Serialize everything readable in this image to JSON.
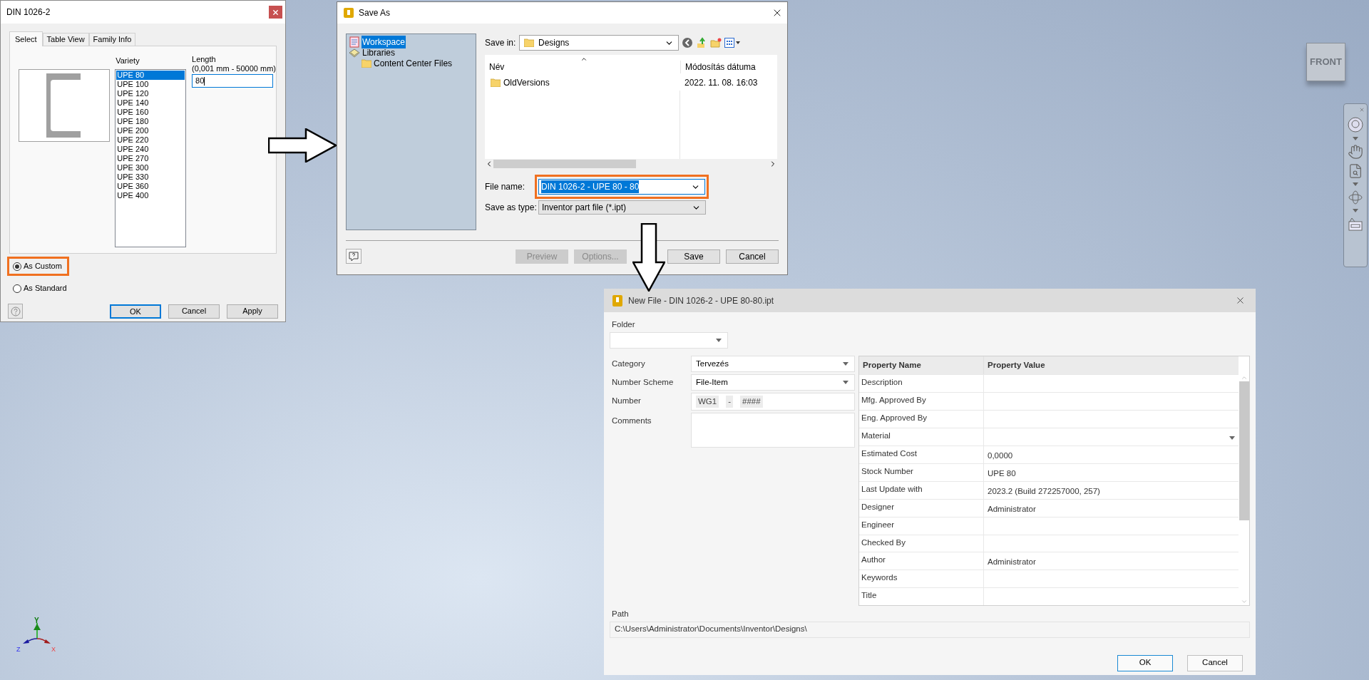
{
  "din_dialog": {
    "title": "DIN 1026-2",
    "tabs": [
      {
        "label": "Select",
        "selected": true
      },
      {
        "label": "Table View",
        "selected": false
      },
      {
        "label": "Family Info",
        "selected": false
      }
    ],
    "variety_label": "Variety",
    "varieties": [
      {
        "label": "UPE 80",
        "selected": true
      },
      {
        "label": "UPE 100",
        "selected": false
      },
      {
        "label": "UPE 120",
        "selected": false
      },
      {
        "label": "UPE 140",
        "selected": false
      },
      {
        "label": "UPE 160",
        "selected": false
      },
      {
        "label": "UPE 180",
        "selected": false
      },
      {
        "label": "UPE 200",
        "selected": false
      },
      {
        "label": "UPE 220",
        "selected": false
      },
      {
        "label": "UPE 240",
        "selected": false
      },
      {
        "label": "UPE 270",
        "selected": false
      },
      {
        "label": "UPE 300",
        "selected": false
      },
      {
        "label": "UPE 330",
        "selected": false
      },
      {
        "label": "UPE 360",
        "selected": false
      },
      {
        "label": "UPE 400",
        "selected": false
      }
    ],
    "length_label": "Length",
    "length_range": "(0,001 mm - 50000 mm)",
    "length_value": "80",
    "options": [
      {
        "label": "As Custom",
        "selected": true,
        "highlighted": true
      },
      {
        "label": "As Standard",
        "selected": false,
        "highlighted": false
      }
    ],
    "buttons": [
      {
        "label": "OK",
        "default": true
      },
      {
        "label": "Cancel",
        "default": false
      },
      {
        "label": "Apply",
        "default": false
      }
    ]
  },
  "save_as": {
    "title": "Save As",
    "places": [
      {
        "label": "Workspace",
        "selected": true,
        "kind": "workspace"
      },
      {
        "label": "Libraries",
        "selected": false,
        "kind": "library",
        "children": [
          {
            "label": "Content Center Files",
            "selected": false,
            "kind": "folder"
          }
        ]
      }
    ],
    "save_in_label": "Save in:",
    "save_in_value": "Designs",
    "columns": [
      "Név",
      "Módosítás dátuma"
    ],
    "files": [
      {
        "name": "OldVersions",
        "modified": "2022. 11. 08. 16:03"
      }
    ],
    "file_name_label": "File name:",
    "file_name": "DIN 1026-2 - UPE 80 - 80",
    "file_name_highlighted": true,
    "type_label": "Save as type:",
    "type_value": "Inventor part file (*.ipt)",
    "buttons": [
      {
        "label": "Preview",
        "disabled": true
      },
      {
        "label": "Options...",
        "disabled": true
      },
      {
        "label": "Save",
        "disabled": false
      },
      {
        "label": "Cancel",
        "disabled": false
      }
    ]
  },
  "new_file": {
    "title": "New File - DIN 1026-2 - UPE 80-80.ipt",
    "folder_label": "Folder",
    "fields": [
      {
        "label": "Category",
        "kind": "dropdown",
        "value": "Tervezés"
      },
      {
        "label": "Number Scheme",
        "kind": "dropdown",
        "value": "File-Item"
      },
      {
        "label": "Number",
        "kind": "segments",
        "segments": [
          "WG1",
          "-",
          "####"
        ]
      },
      {
        "label": "Comments",
        "kind": "textarea"
      }
    ],
    "columns": [
      "Property Name",
      "Property Value"
    ],
    "properties": [
      {
        "name": "Description",
        "kind": "text"
      },
      {
        "name": "Mfg. Approved By",
        "kind": "text"
      },
      {
        "name": "Eng. Approved By",
        "kind": "text"
      },
      {
        "name": "Material",
        "kind": "dropdown"
      },
      {
        "name": "Estimated Cost",
        "kind": "text",
        "value": "0,0000"
      },
      {
        "name": "Stock Number",
        "kind": "text",
        "value": "UPE 80"
      },
      {
        "name": "Last Update with",
        "kind": "text",
        "value": "2023.2 (Build 272257000, 257)"
      },
      {
        "name": "Designer",
        "kind": "text",
        "value": "Administrator"
      },
      {
        "name": "Engineer",
        "kind": "text"
      },
      {
        "name": "Checked By",
        "kind": "text"
      },
      {
        "name": "Author",
        "kind": "text",
        "value": "Administrator"
      },
      {
        "name": "Keywords",
        "kind": "text"
      },
      {
        "name": "Title",
        "kind": "text"
      }
    ],
    "path_label": "Path",
    "path": "C:\\Users\\Administrator\\Documents\\Inventor\\Designs\\",
    "buttons": [
      {
        "label": "OK",
        "default": true
      },
      {
        "label": "Cancel",
        "default": false
      }
    ]
  },
  "view_cube": {
    "label": "FRONT"
  },
  "axis_triad": {
    "x": "X",
    "y": "Y",
    "z": "Z"
  }
}
